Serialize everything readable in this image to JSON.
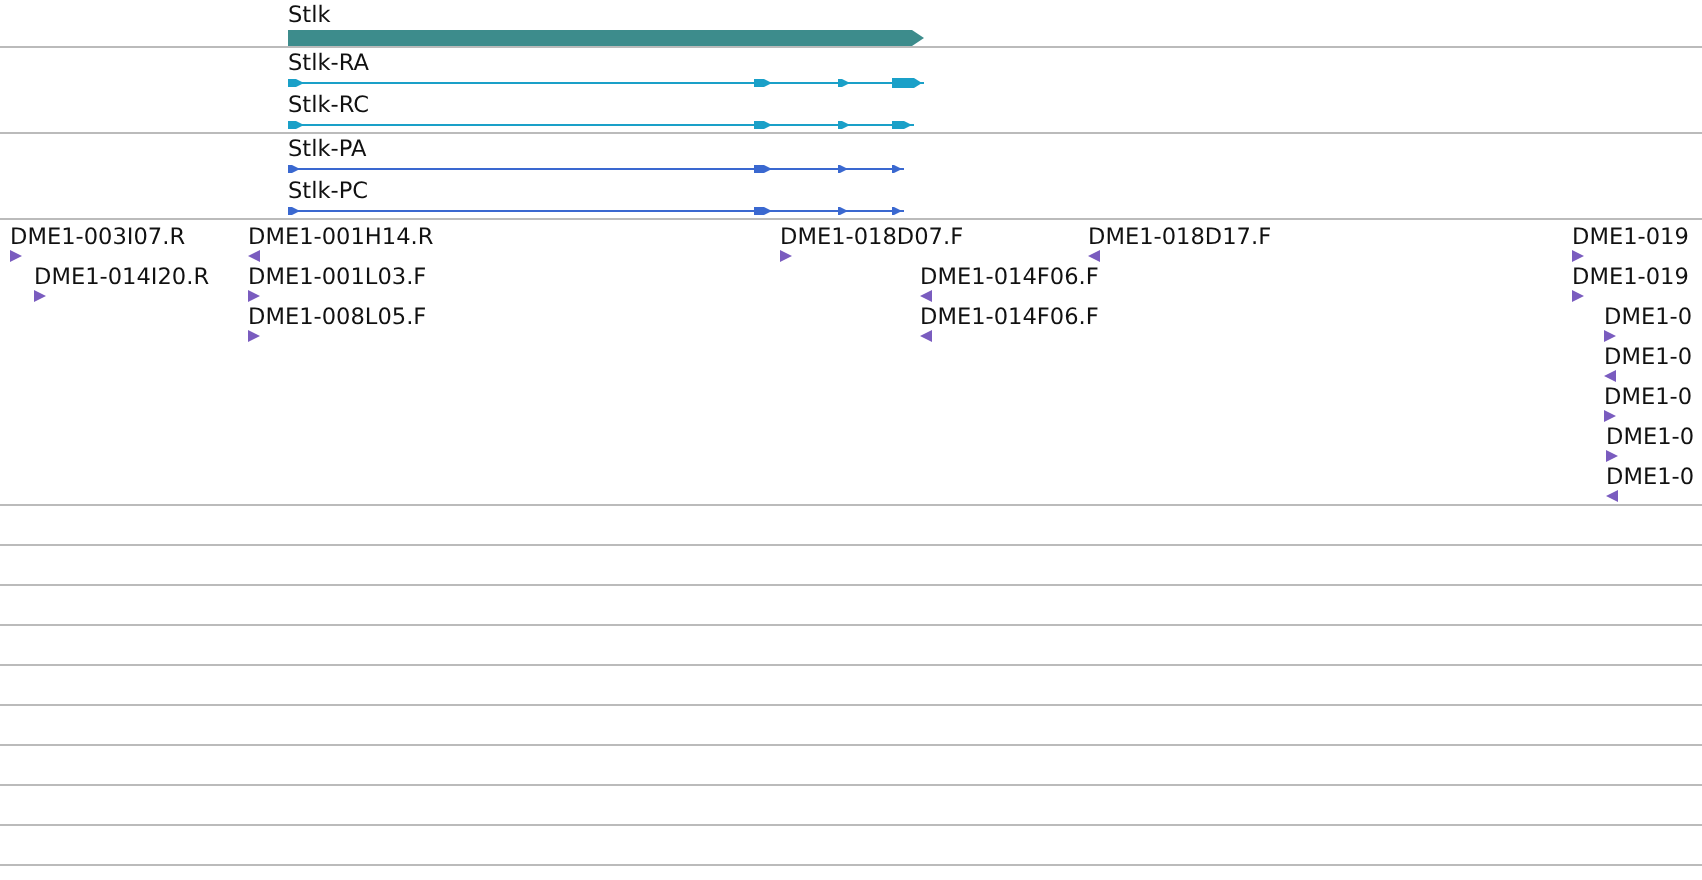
{
  "tracks": [
    {
      "kind": "gene",
      "features": [
        {
          "label": "Stlk"
        }
      ]
    },
    {
      "kind": "transcript",
      "features": [
        {
          "label": "Stlk-RA"
        },
        {
          "label": "Stlk-RC"
        }
      ]
    },
    {
      "kind": "protein",
      "features": [
        {
          "label": "Stlk-PA"
        },
        {
          "label": "Stlk-PC"
        }
      ]
    },
    {
      "kind": "clone",
      "features": [
        {
          "label": "DME1-003I07.R",
          "reverse": false
        },
        {
          "label": "DME1-014I20.R",
          "reverse": false
        },
        {
          "label": "DME1-001H14.R",
          "reverse": true
        },
        {
          "label": "DME1-001L03.F",
          "reverse": false
        },
        {
          "label": "DME1-008L05.F",
          "reverse": false
        },
        {
          "label": "DME1-018D07.F",
          "reverse": false
        },
        {
          "label": "DME1-014F06.F",
          "reverse": true
        },
        {
          "label": "DME1-014F06.F",
          "reverse": true
        },
        {
          "label": "DME1-018D17.F",
          "reverse": true
        },
        {
          "label": "DME1-019",
          "reverse": false
        },
        {
          "label": "DME1-019",
          "reverse": false
        },
        {
          "label": "DME1-0",
          "reverse": false
        },
        {
          "label": "DME1-0",
          "reverse": true
        },
        {
          "label": "DME1-0",
          "reverse": false
        },
        {
          "label": "DME1-0",
          "reverse": false
        },
        {
          "label": "DME1-0",
          "reverse": true
        }
      ]
    }
  ]
}
